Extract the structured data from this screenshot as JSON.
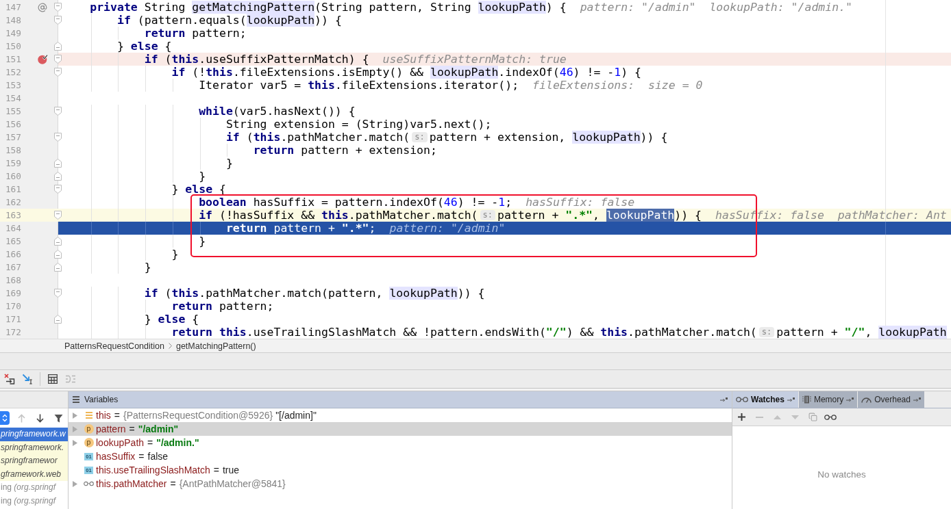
{
  "editor": {
    "blocks": [
      {
        "kind": "plain",
        "lines": [
          {
            "number": "147",
            "gutter": {
              "kind": "annotation"
            },
            "fold": {
              "kind": "start"
            },
            "segments": [
              {
                "kind": "code",
                "tokens": [
                  {
                    "kind": "keyword",
                    "text": "    private"
                  },
                  {
                    "kind": "plain",
                    "text": " String "
                  },
                  {
                    "kind": "usage",
                    "text": "getMatchingPattern"
                  },
                  {
                    "kind": "plain",
                    "text": "(String pattern, String "
                  },
                  {
                    "kind": "usage",
                    "text": "lookupPath"
                  },
                  {
                    "kind": "plain",
                    "text": ") {"
                  }
                ]
              },
              {
                "kind": "inline_value",
                "text": "pattern: \"/admin\"  lookupPath: \"/admin.\""
              }
            ]
          },
          {
            "number": "148",
            "fold": {
              "kind": "start"
            },
            "segments": [
              {
                "kind": "code",
                "tokens": [
                  {
                    "kind": "keyword",
                    "text": "        if"
                  },
                  {
                    "kind": "plain",
                    "text": " (pattern.equals("
                  },
                  {
                    "kind": "usage",
                    "text": "lookupPath"
                  },
                  {
                    "kind": "plain",
                    "text": ")) {"
                  }
                ]
              }
            ]
          },
          {
            "number": "149",
            "segments": [
              {
                "kind": "code",
                "tokens": [
                  {
                    "kind": "keyword",
                    "text": "            return"
                  },
                  {
                    "kind": "plain",
                    "text": " pattern;"
                  }
                ]
              }
            ]
          },
          {
            "number": "150",
            "fold": {
              "kind": "end"
            },
            "segments": [
              {
                "kind": "code",
                "tokens": [
                  {
                    "kind": "plain",
                    "text": "        } "
                  },
                  {
                    "kind": "keyword",
                    "text": "else"
                  },
                  {
                    "kind": "plain",
                    "text": " {"
                  }
                ]
              }
            ]
          },
          {
            "number": "151",
            "gutter": {
              "kind": "breakpoint"
            },
            "fold": {
              "kind": "start"
            },
            "highlight": {
              "kind": "breakpoint"
            },
            "segments": [
              {
                "kind": "code",
                "tokens": [
                  {
                    "kind": "keyword",
                    "text": "            if"
                  },
                  {
                    "kind": "plain",
                    "text": " ("
                  },
                  {
                    "kind": "keyword",
                    "text": "this"
                  },
                  {
                    "kind": "plain",
                    "text": ".useSuffixPatternMatch) {"
                  }
                ]
              },
              {
                "kind": "inline_value",
                "text": "useSuffixPatternMatch: true"
              }
            ]
          },
          {
            "number": "152",
            "fold": {
              "kind": "start"
            },
            "segments": [
              {
                "kind": "code",
                "tokens": [
                  {
                    "kind": "keyword",
                    "text": "                if"
                  },
                  {
                    "kind": "plain",
                    "text": " (!"
                  },
                  {
                    "kind": "keyword",
                    "text": "this"
                  },
                  {
                    "kind": "plain",
                    "text": ".fileExtensions.isEmpty() && "
                  },
                  {
                    "kind": "usage",
                    "text": "lookupPath"
                  },
                  {
                    "kind": "plain",
                    "text": ".indexOf("
                  },
                  {
                    "kind": "number",
                    "text": "46"
                  },
                  {
                    "kind": "plain",
                    "text": ") != -"
                  },
                  {
                    "kind": "number",
                    "text": "1"
                  },
                  {
                    "kind": "plain",
                    "text": ") {"
                  }
                ]
              }
            ]
          },
          {
            "number": "153",
            "segments": [
              {
                "kind": "code",
                "tokens": [
                  {
                    "kind": "plain",
                    "text": "                    Iterator var5 = "
                  },
                  {
                    "kind": "keyword",
                    "text": "this"
                  },
                  {
                    "kind": "plain",
                    "text": ".fileExtensions.iterator();"
                  }
                ]
              },
              {
                "kind": "inline_value",
                "text": "fileExtensions:  size = 0"
              }
            ]
          },
          {
            "number": "154"
          },
          {
            "number": "155",
            "fold": {
              "kind": "start"
            },
            "segments": [
              {
                "kind": "code",
                "tokens": [
                  {
                    "kind": "keyword",
                    "text": "                    while"
                  },
                  {
                    "kind": "plain",
                    "text": "(var5.hasNext()) {"
                  }
                ]
              }
            ]
          },
          {
            "number": "156",
            "segments": [
              {
                "kind": "code",
                "tokens": [
                  {
                    "kind": "plain",
                    "text": "                        String extension = (String)var5.next();"
                  }
                ]
              }
            ]
          },
          {
            "number": "157",
            "fold": {
              "kind": "start"
            },
            "segments": [
              {
                "kind": "code",
                "tokens": [
                  {
                    "kind": "keyword",
                    "text": "                        if"
                  },
                  {
                    "kind": "plain",
                    "text": " ("
                  },
                  {
                    "kind": "keyword",
                    "text": "this"
                  },
                  {
                    "kind": "plain",
                    "text": ".pathMatcher.match("
                  }
                ]
              },
              {
                "kind": "param_hint",
                "text": "s:"
              },
              {
                "kind": "code",
                "tokens": [
                  {
                    "kind": "plain",
                    "text": "pattern + extension, "
                  },
                  {
                    "kind": "usage",
                    "text": "lookupPath"
                  },
                  {
                    "kind": "plain",
                    "text": ")) {"
                  }
                ]
              }
            ]
          },
          {
            "number": "158",
            "segments": [
              {
                "kind": "code",
                "tokens": [
                  {
                    "kind": "keyword",
                    "text": "                            return"
                  },
                  {
                    "kind": "plain",
                    "text": " pattern + extension;"
                  }
                ]
              }
            ]
          },
          {
            "number": "159",
            "fold": {
              "kind": "end"
            },
            "segments": [
              {
                "kind": "code",
                "tokens": [
                  {
                    "kind": "plain",
                    "text": "                        }"
                  }
                ]
              }
            ]
          },
          {
            "number": "160",
            "fold": {
              "kind": "end"
            },
            "segments": [
              {
                "kind": "code",
                "tokens": [
                  {
                    "kind": "plain",
                    "text": "                    }"
                  }
                ]
              }
            ]
          },
          {
            "number": "161",
            "fold": {
              "kind": "start"
            },
            "segments": [
              {
                "kind": "code",
                "tokens": [
                  {
                    "kind": "plain",
                    "text": "                } "
                  },
                  {
                    "kind": "keyword",
                    "text": "else"
                  },
                  {
                    "kind": "plain",
                    "text": " {"
                  }
                ]
              }
            ]
          }
        ]
      },
      {
        "kind": "boxed",
        "lines": [
          {
            "number": "162",
            "segments": [
              {
                "kind": "code",
                "tokens": [
                  {
                    "kind": "keyword",
                    "text": "                    boolean"
                  },
                  {
                    "kind": "plain",
                    "text": " hasSuffix = pattern.indexOf("
                  },
                  {
                    "kind": "number",
                    "text": "46"
                  },
                  {
                    "kind": "plain",
                    "text": ") != -"
                  },
                  {
                    "kind": "number",
                    "text": "1"
                  },
                  {
                    "kind": "plain",
                    "text": ";"
                  }
                ]
              },
              {
                "kind": "inline_value",
                "text": "hasSuffix: false"
              }
            ]
          },
          {
            "number": "163",
            "fold": {
              "kind": "start"
            },
            "highlight": {
              "kind": "caret"
            },
            "segments": [
              {
                "kind": "code",
                "tokens": [
                  {
                    "kind": "keyword",
                    "text": "                    if"
                  },
                  {
                    "kind": "plain",
                    "text": " (!hasSuffix && "
                  },
                  {
                    "kind": "keyword",
                    "text": "this"
                  },
                  {
                    "kind": "plain",
                    "text": ".pathMatcher.match("
                  }
                ]
              },
              {
                "kind": "param_hint",
                "text": "s:"
              },
              {
                "kind": "code",
                "tokens": [
                  {
                    "kind": "plain",
                    "text": "pattern + "
                  },
                  {
                    "kind": "string",
                    "text": "\".*\""
                  },
                  {
                    "kind": "plain",
                    "text": ", "
                  },
                  {
                    "kind": "selection",
                    "text": "lookupPath"
                  },
                  {
                    "kind": "plain",
                    "text": ")) {"
                  }
                ]
              },
              {
                "kind": "inline_value",
                "text": "hasSuffix: false  pathMatcher: Ant"
              }
            ]
          },
          {
            "number": "164",
            "highlight": {
              "kind": "execution"
            },
            "segments": [
              {
                "kind": "code",
                "tokens": [
                  {
                    "kind": "keyword",
                    "text": "                        return"
                  },
                  {
                    "kind": "plain",
                    "text": " pattern + "
                  },
                  {
                    "kind": "string",
                    "text": "\".*\""
                  },
                  {
                    "kind": "plain",
                    "text": ";"
                  }
                ]
              },
              {
                "kind": "inline_value",
                "text": "pattern: \"/admin\""
              }
            ]
          },
          {
            "number": "165",
            "fold": {
              "kind": "end"
            },
            "segments": [
              {
                "kind": "code",
                "tokens": [
                  {
                    "kind": "plain",
                    "text": "                    }"
                  }
                ]
              }
            ]
          }
        ]
      },
      {
        "kind": "plain",
        "lines": [
          {
            "number": "166",
            "fold": {
              "kind": "end"
            },
            "segments": [
              {
                "kind": "code",
                "tokens": [
                  {
                    "kind": "plain",
                    "text": "                }"
                  }
                ]
              }
            ]
          },
          {
            "number": "167",
            "fold": {
              "kind": "end"
            },
            "segments": [
              {
                "kind": "code",
                "tokens": [
                  {
                    "kind": "plain",
                    "text": "            }"
                  }
                ]
              }
            ]
          },
          {
            "number": "168"
          },
          {
            "number": "169",
            "fold": {
              "kind": "start"
            },
            "segments": [
              {
                "kind": "code",
                "tokens": [
                  {
                    "kind": "keyword",
                    "text": "            if"
                  },
                  {
                    "kind": "plain",
                    "text": " ("
                  },
                  {
                    "kind": "keyword",
                    "text": "this"
                  },
                  {
                    "kind": "plain",
                    "text": ".pathMatcher.match(pattern, "
                  },
                  {
                    "kind": "usage",
                    "text": "lookupPath"
                  },
                  {
                    "kind": "plain",
                    "text": ")) {"
                  }
                ]
              }
            ]
          },
          {
            "number": "170",
            "segments": [
              {
                "kind": "code",
                "tokens": [
                  {
                    "kind": "keyword",
                    "text": "                return"
                  },
                  {
                    "kind": "plain",
                    "text": " pattern;"
                  }
                ]
              }
            ]
          },
          {
            "number": "171",
            "fold": {
              "kind": "end"
            },
            "segments": [
              {
                "kind": "code",
                "tokens": [
                  {
                    "kind": "plain",
                    "text": "            } "
                  },
                  {
                    "kind": "keyword",
                    "text": "else"
                  },
                  {
                    "kind": "plain",
                    "text": " {"
                  }
                ]
              }
            ]
          },
          {
            "number": "172",
            "segments": [
              {
                "kind": "code",
                "tokens": [
                  {
                    "kind": "keyword",
                    "text": "                return this"
                  },
                  {
                    "kind": "plain",
                    "text": ".useTrailingSlashMatch && !pattern.endsWith("
                  },
                  {
                    "kind": "string",
                    "text": "\"/\""
                  },
                  {
                    "kind": "plain",
                    "text": ") && "
                  },
                  {
                    "kind": "keyword",
                    "text": "this"
                  },
                  {
                    "kind": "plain",
                    "text": ".pathMatcher.match("
                  }
                ]
              },
              {
                "kind": "param_hint",
                "text": "s:"
              },
              {
                "kind": "code",
                "tokens": [
                  {
                    "kind": "plain",
                    "text": "pattern + "
                  },
                  {
                    "kind": "string",
                    "text": "\"/\""
                  },
                  {
                    "kind": "plain",
                    "text": ", "
                  },
                  {
                    "kind": "usage",
                    "text": "lookupPath"
                  }
                ]
              }
            ]
          }
        ]
      }
    ]
  },
  "breadcrumb": [
    "PatternsRequestCondition",
    "getMatchingPattern()"
  ],
  "debug_toolbar": {
    "groups": [
      {
        "buttons": [
          {
            "kind": "drop_frame",
            "disabled": false
          },
          {
            "kind": "force_step_into",
            "disabled": false
          }
        ]
      },
      {
        "buttons": [
          {
            "kind": "evaluate",
            "disabled": false
          },
          {
            "kind": "trace",
            "disabled": true
          }
        ]
      }
    ]
  },
  "frames": {
    "controls": [
      {
        "kind": "up",
        "disabled": true
      },
      {
        "kind": "down",
        "disabled": false
      },
      {
        "kind": "filter",
        "disabled": false
      }
    ],
    "items": [
      {
        "text": "pringframework.w",
        "kind": "library",
        "selected": true
      },
      {
        "text": "springframework.",
        "kind": "library",
        "selected": false
      },
      {
        "text": "springframewor",
        "kind": "library",
        "selected": false
      },
      {
        "text": "gframework.web",
        "kind": "library",
        "selected": false
      },
      {
        "text": "ing *(org.springf*",
        "kind": "plain",
        "selected": false
      },
      {
        "text": "ing *(org.springf*",
        "kind": "plain",
        "selected": false
      }
    ]
  },
  "variables": {
    "title": "Variables",
    "rows": [
      {
        "kind": "field",
        "expandable": true,
        "selected": false,
        "name": "this",
        "operator": "=",
        "type_info": "{PatternsRequestCondition@5926}",
        "value": {
          "kind": "plain",
          "text": "\"[/admin]\""
        }
      },
      {
        "kind": "param",
        "badge": "p",
        "expandable": true,
        "selected": true,
        "name": "pattern",
        "operator": "=",
        "value": {
          "kind": "string",
          "text": "\"/admin\""
        }
      },
      {
        "kind": "param",
        "badge": "p",
        "expandable": true,
        "selected": false,
        "name": "lookupPath",
        "operator": "=",
        "value": {
          "kind": "string",
          "text": "\"/admin.\""
        }
      },
      {
        "kind": "local",
        "badge": "01",
        "expandable": false,
        "selected": false,
        "name": "hasSuffix",
        "operator": "=",
        "value": {
          "kind": "plain",
          "text": "false"
        }
      },
      {
        "kind": "local",
        "badge": "01",
        "expandable": false,
        "selected": false,
        "name": "this.useTrailingSlashMatch",
        "operator": "=",
        "value": {
          "kind": "plain",
          "text": "true"
        }
      },
      {
        "kind": "watch",
        "expandable": true,
        "selected": false,
        "name": "this.pathMatcher",
        "operator": "=",
        "type_info": "{AntPathMatcher@5841}"
      }
    ]
  },
  "side_tabs": [
    {
      "kind": "watches",
      "label": "Watches",
      "selected": true
    },
    {
      "kind": "memory",
      "label": "Memory",
      "selected": false
    },
    {
      "kind": "overhead",
      "label": "Overhead",
      "selected": false
    }
  ],
  "watches": {
    "toolbar": [
      {
        "kind": "add",
        "disabled": false
      },
      {
        "kind": "remove",
        "disabled": true
      },
      {
        "kind": "move_up",
        "disabled": true
      },
      {
        "kind": "move_down",
        "disabled": true
      },
      {
        "kind": "duplicate",
        "disabled": true
      },
      {
        "kind": "show_inline",
        "disabled": false
      }
    ],
    "empty_text": "No watches"
  }
}
